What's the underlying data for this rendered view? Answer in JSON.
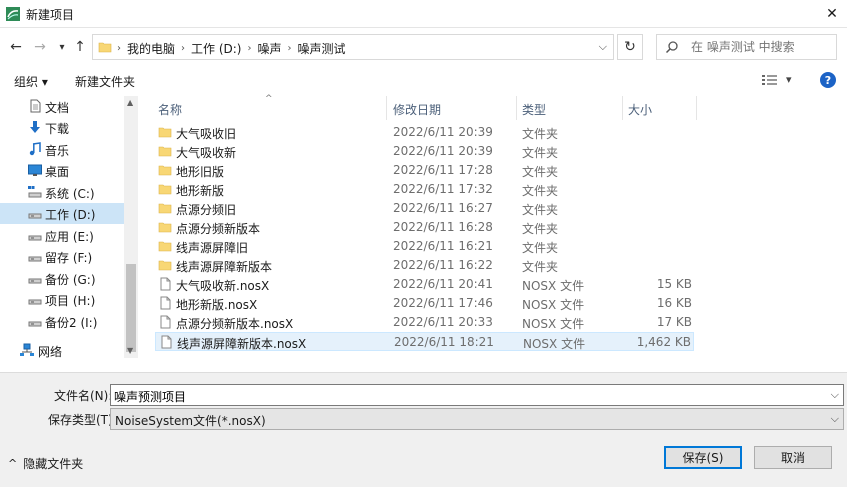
{
  "window": {
    "title": "新建项目",
    "close_glyph": "✕"
  },
  "address": {
    "back_glyph": "←",
    "forward_glyph": "→",
    "recent_glyph": "▾",
    "up_glyph": "↑",
    "crumbs": [
      "我的电脑",
      "工作 (D:)",
      "噪声",
      "噪声测试"
    ],
    "separator": "›",
    "dropdown_glyph": "⌵",
    "refresh_glyph": "↻"
  },
  "search": {
    "placeholder": "在 噪声测试 中搜索"
  },
  "toolbar": {
    "organize": "组织 ▾",
    "new_folder": "新建文件夹",
    "view_dropdown": "▾",
    "help": "?"
  },
  "sidebar": {
    "items": [
      {
        "label": "文档",
        "icon": "document-icon"
      },
      {
        "label": "下载",
        "icon": "download-icon"
      },
      {
        "label": "音乐",
        "icon": "music-icon"
      },
      {
        "label": "桌面",
        "icon": "desktop-icon"
      },
      {
        "label": "系统 (C:)",
        "icon": "system-drive-icon"
      },
      {
        "label": "工作 (D:)",
        "icon": "drive-icon",
        "selected": true
      },
      {
        "label": "应用 (E:)",
        "icon": "drive-icon"
      },
      {
        "label": "留存 (F:)",
        "icon": "drive-icon"
      },
      {
        "label": "备份 (G:)",
        "icon": "drive-icon"
      },
      {
        "label": "项目 (H:)",
        "icon": "drive-icon"
      },
      {
        "label": "备份2 (I:)",
        "icon": "drive-icon"
      },
      {
        "label": "网络",
        "icon": "network-icon"
      }
    ],
    "scroll_up": "▲",
    "scroll_down": "▼"
  },
  "columns": {
    "name": "名称",
    "modified": "修改日期",
    "type": "类型",
    "size": "大小",
    "sort_indicator": "^"
  },
  "files": [
    {
      "name": "大气吸收旧",
      "date": "2022/6/11 20:39",
      "type": "文件夹",
      "size": "",
      "kind": "folder"
    },
    {
      "name": "大气吸收新",
      "date": "2022/6/11 20:39",
      "type": "文件夹",
      "size": "",
      "kind": "folder"
    },
    {
      "name": "地形旧版",
      "date": "2022/6/11 17:28",
      "type": "文件夹",
      "size": "",
      "kind": "folder"
    },
    {
      "name": "地形新版",
      "date": "2022/6/11 17:32",
      "type": "文件夹",
      "size": "",
      "kind": "folder"
    },
    {
      "name": "点源分频旧",
      "date": "2022/6/11 16:27",
      "type": "文件夹",
      "size": "",
      "kind": "folder"
    },
    {
      "name": "点源分频新版本",
      "date": "2022/6/11 16:28",
      "type": "文件夹",
      "size": "",
      "kind": "folder"
    },
    {
      "name": "线声源屏障旧",
      "date": "2022/6/11 16:21",
      "type": "文件夹",
      "size": "",
      "kind": "folder"
    },
    {
      "name": "线声源屏障新版本",
      "date": "2022/6/11 16:22",
      "type": "文件夹",
      "size": "",
      "kind": "folder"
    },
    {
      "name": "大气吸收新.nosX",
      "date": "2022/6/11 20:41",
      "type": "NOSX 文件",
      "size": "15 KB",
      "kind": "file"
    },
    {
      "name": "地形新版.nosX",
      "date": "2022/6/11 17:46",
      "type": "NOSX 文件",
      "size": "16 KB",
      "kind": "file"
    },
    {
      "name": "点源分频新版本.nosX",
      "date": "2022/6/11 20:33",
      "type": "NOSX 文件",
      "size": "17 KB",
      "kind": "file"
    },
    {
      "name": "线声源屏障新版本.nosX",
      "date": "2022/6/11 18:21",
      "type": "NOSX 文件",
      "size": "1,462 KB",
      "kind": "file",
      "highlighted": true
    }
  ],
  "form": {
    "filename_label": "文件名(N):",
    "filename_value": "噪声预测项目",
    "filetype_label": "保存类型(T):",
    "filetype_value": "NoiseSystem文件(*.nosX)",
    "dropdown_glyph": "⌵"
  },
  "footer": {
    "hide_folders": "隐藏文件夹",
    "hide_glyph": "^",
    "save": "保存(S)",
    "cancel": "取消"
  },
  "colors": {
    "folder": "#f8d775",
    "accent": "#0078d7",
    "selected": "#cce4f7",
    "hover": "#e5f1fb"
  }
}
